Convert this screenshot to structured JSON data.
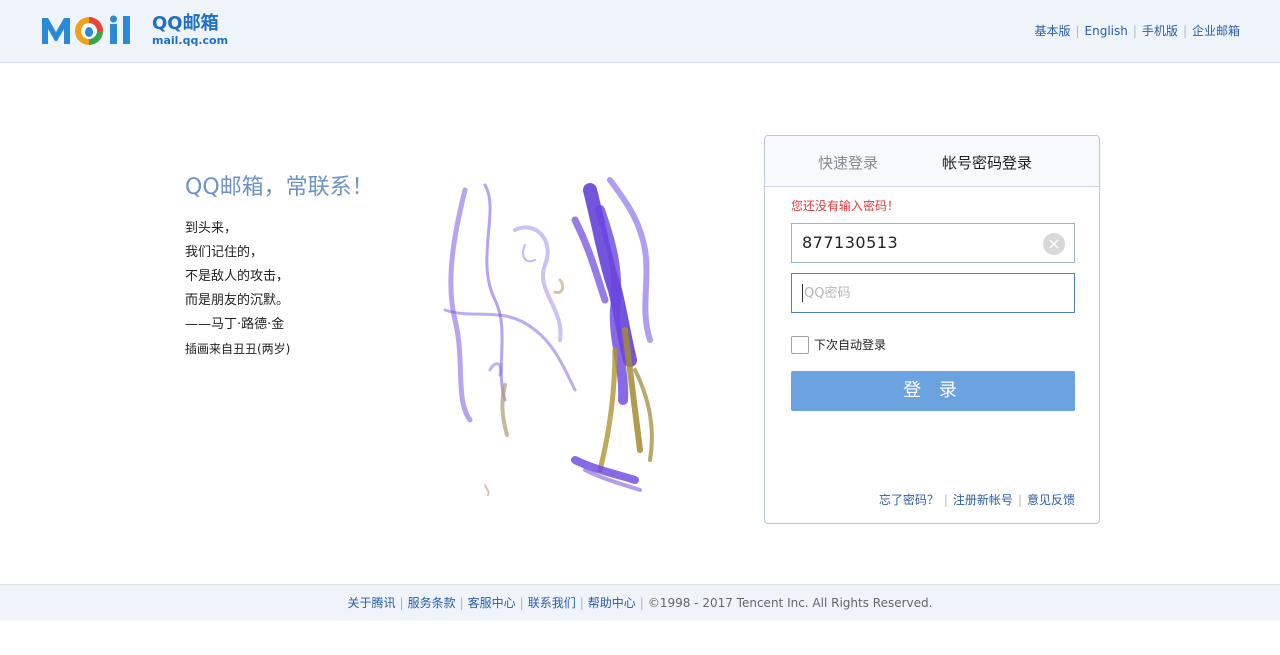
{
  "header": {
    "logo_title": "QQ邮箱",
    "logo_sub": "mail.qq.com",
    "links": [
      "基本版",
      "English",
      "手机版",
      "企业邮箱"
    ]
  },
  "intro": {
    "slogan": "QQ邮箱，常联系！",
    "poem": [
      "到头来，",
      "我们记住的，",
      "不是敌人的攻击，",
      "而是朋友的沉默。",
      "——马丁·路德·金"
    ],
    "credit": "插画来自丑丑(两岁)"
  },
  "login": {
    "tab_quick": "快速登录",
    "tab_account": "帐号密码登录",
    "error": "您还没有输入密码！",
    "username_value": "877130513",
    "password_placeholder": "QQ密码",
    "remember_label": "下次自动登录",
    "login_button": "登 录",
    "links": [
      "忘了密码？",
      "注册新帐号",
      "意见反馈"
    ]
  },
  "footer": {
    "links": [
      "关于腾讯",
      "服务条款",
      "客服中心",
      "联系我们",
      "帮助中心"
    ],
    "copyright": "©1998 - 2017 Tencent Inc. All Rights Reserved."
  },
  "colors": {
    "brand": "#1f6fc4",
    "header_bg": "#eff4fb",
    "link": "#2b5da8",
    "error": "#e03a3a",
    "button": "#6ba2e0",
    "slogan": "#6c92c7"
  }
}
